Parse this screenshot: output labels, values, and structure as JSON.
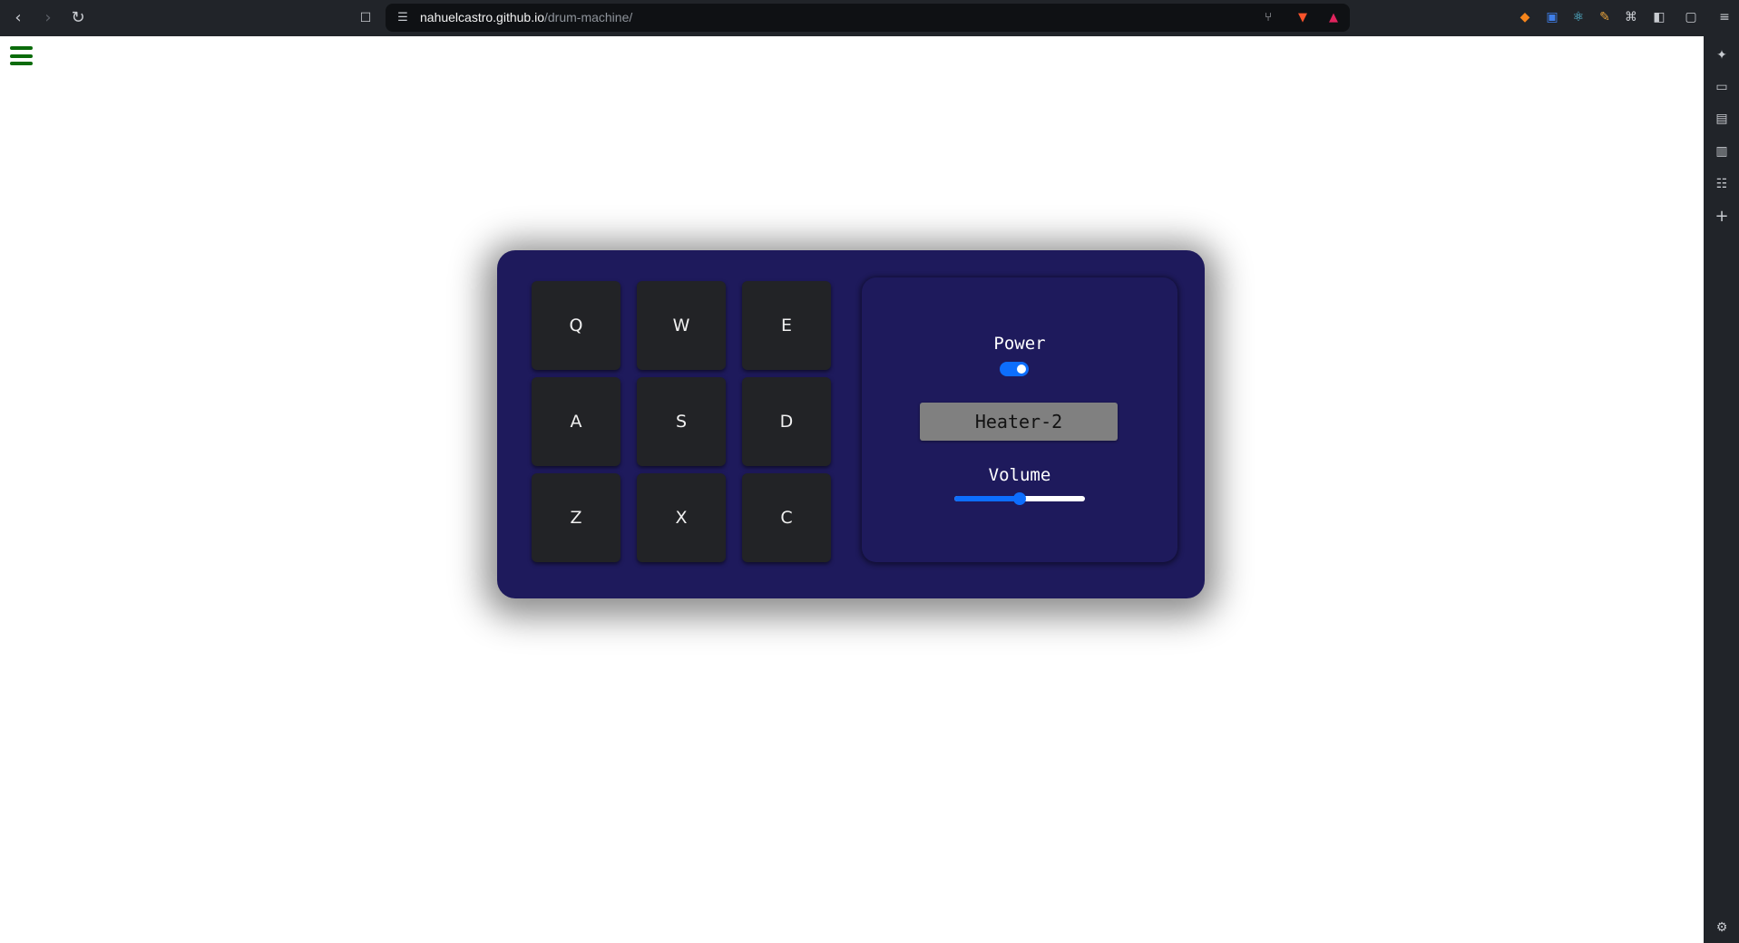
{
  "browser": {
    "url_domain": "nahuelcastro.github.io",
    "url_path": "/drum-machine/"
  },
  "drum_machine": {
    "pads": [
      "Q",
      "W",
      "E",
      "A",
      "S",
      "D",
      "Z",
      "X",
      "C"
    ],
    "power_label": "Power",
    "power_on": true,
    "display_text": "Heater-2",
    "volume_label": "Volume",
    "volume_level": 0.5
  },
  "colors": {
    "machine_bg": "#1e1a5c",
    "pad_bg": "#222326",
    "accent": "#0d6efd",
    "display_bg": "#808080",
    "menu_icon": "#0b6b0b"
  }
}
